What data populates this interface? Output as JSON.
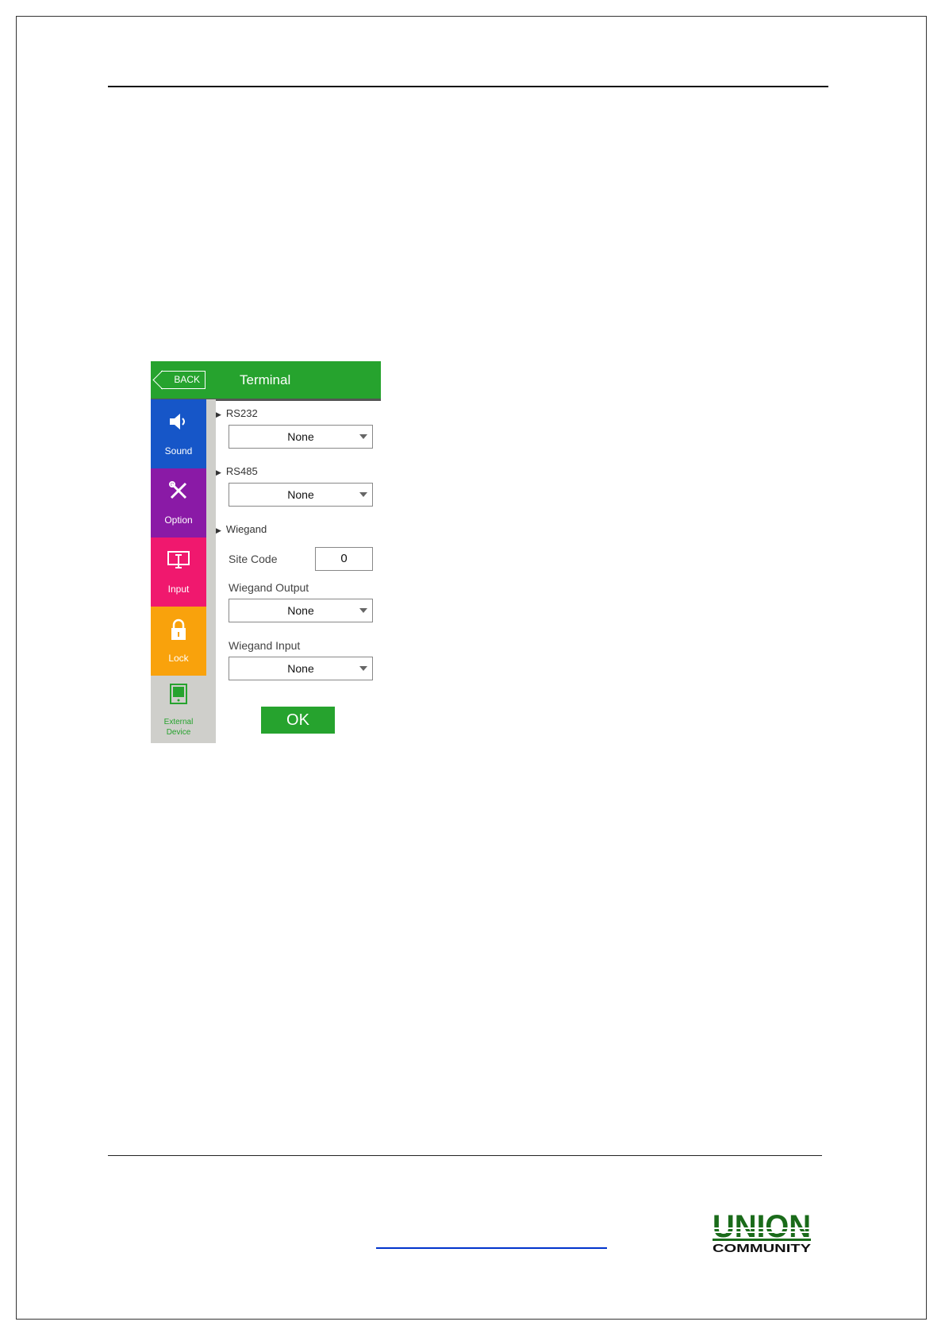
{
  "screen": {
    "back_label": "BACK",
    "title": "Terminal",
    "sidebar": [
      {
        "label": "Sound",
        "icon": "speaker-icon"
      },
      {
        "label": "Option",
        "icon": "tools-icon"
      },
      {
        "label": "Input",
        "icon": "monitor-icon"
      },
      {
        "label": "Lock",
        "icon": "lock-icon"
      },
      {
        "label_line1": "External",
        "label_line2": "Device",
        "icon": "tablet-icon"
      }
    ],
    "rs232": {
      "label": "RS232",
      "value": "None"
    },
    "rs485": {
      "label": "RS485",
      "value": "None"
    },
    "wiegand": {
      "label": "Wiegand",
      "site_code_label": "Site Code",
      "site_code_value": "0",
      "output_label": "Wiegand Output",
      "output_value": "None",
      "input_label": "Wiegand Input",
      "input_value": "None"
    },
    "ok_label": "OK"
  },
  "logo": {
    "line1": "UNION",
    "line2": "COMMUNITY",
    "color": "#1a6b1a"
  },
  "colors": {
    "green": "#26a32e",
    "sound": "#1656c8",
    "option": "#8a1aa6",
    "input": "#f0186e",
    "lock": "#f9a20c"
  }
}
